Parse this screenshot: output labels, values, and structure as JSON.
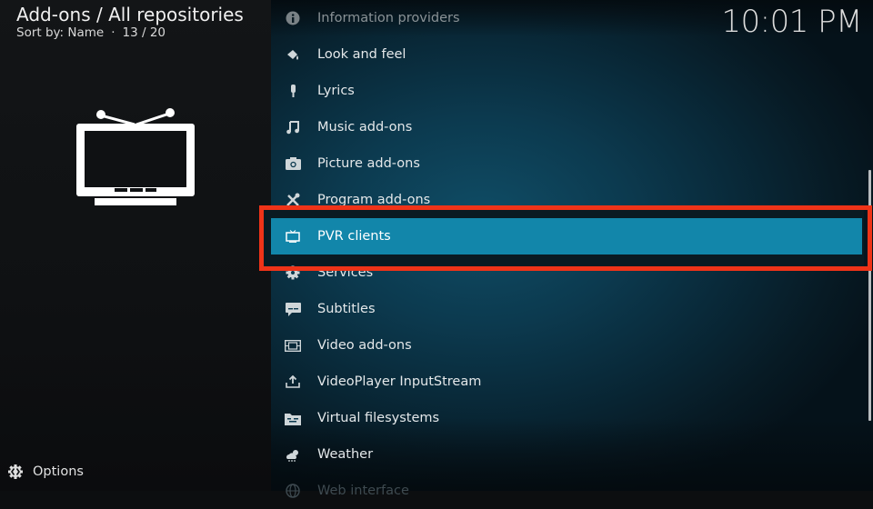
{
  "header": {
    "title": "Add-ons / All repositories",
    "sort_label": "Sort by: Name",
    "separator": "·",
    "position": "13 / 20"
  },
  "clock": "10:01 PM",
  "preview": {
    "icon": "tv-icon"
  },
  "list": {
    "items": [
      {
        "label": "Information providers",
        "icon": "info-icon",
        "state": "dim"
      },
      {
        "label": "Look and feel",
        "icon": "paint-bucket-icon",
        "state": "normal"
      },
      {
        "label": "Lyrics",
        "icon": "microphone-icon",
        "state": "normal"
      },
      {
        "label": "Music add-ons",
        "icon": "music-note-icon",
        "state": "normal"
      },
      {
        "label": "Picture add-ons",
        "icon": "camera-icon",
        "state": "normal"
      },
      {
        "label": "Program add-ons",
        "icon": "tools-icon",
        "state": "normal"
      },
      {
        "label": "PVR clients",
        "icon": "tv-icon",
        "state": "selected"
      },
      {
        "label": "Services",
        "icon": "gear-icon",
        "state": "normal"
      },
      {
        "label": "Subtitles",
        "icon": "subtitles-icon",
        "state": "normal"
      },
      {
        "label": "Video add-ons",
        "icon": "film-icon",
        "state": "normal"
      },
      {
        "label": "VideoPlayer InputStream",
        "icon": "download-tray-icon",
        "state": "normal"
      },
      {
        "label": "Virtual filesystems",
        "icon": "folder-zip-icon",
        "state": "normal"
      },
      {
        "label": "Weather",
        "icon": "weather-icon",
        "state": "normal"
      },
      {
        "label": "Web interface",
        "icon": "globe-icon",
        "state": "faded"
      }
    ]
  },
  "annotation": {
    "highlight_color": "#ef3318",
    "target": "PVR clients"
  },
  "colors": {
    "selected_bg": "#1286aa"
  },
  "footer": {
    "options_label": "Options"
  }
}
